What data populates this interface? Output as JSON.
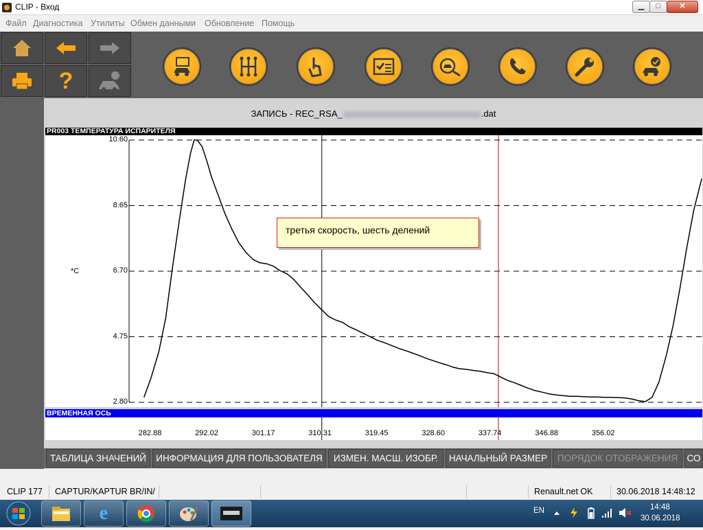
{
  "window": {
    "title": "CLIP - Вход",
    "min_glyph": "▁",
    "max_glyph": "□",
    "close_glyph": "✕"
  },
  "menu": {
    "items": [
      "Файл",
      "Диагностика",
      "Утилиты",
      "Обмен данными",
      "Обновление",
      "Помощь"
    ]
  },
  "toolbar": {
    "nav_buttons": [
      {
        "name": "home-icon"
      },
      {
        "name": "back-arrow-icon"
      },
      {
        "name": "forward-arrow-icon"
      },
      {
        "name": "printer-icon"
      },
      {
        "name": "help-icon",
        "glyph": "?"
      },
      {
        "name": "vehicle-info-icon"
      }
    ],
    "tool_buttons": [
      {
        "name": "vehicle-identification-icon"
      },
      {
        "name": "gearbox-icon"
      },
      {
        "name": "touch-test-icon"
      },
      {
        "name": "checklist-icon"
      },
      {
        "name": "vehicle-scan-icon"
      },
      {
        "name": "phone-support-icon"
      },
      {
        "name": "wrench-icon"
      },
      {
        "name": "vehicle-ok-icon"
      }
    ],
    "accent": "#f8a815"
  },
  "recording": {
    "prefix": "ЗАПИСЬ - REC_RSA_",
    "suffix": ".dat"
  },
  "plot": {
    "header": "PR003  ТЕМПЕРАТУРА ИСПАРИТЕЛЯ",
    "unit": "*C",
    "axis_header": "ВРЕМЕННАЯ ОСЬ",
    "annotation": "третья скорость, шесть делений"
  },
  "chart_data": {
    "type": "line",
    "title": "PR003  ТЕМПЕРАТУРА ИСПАРИТЕЛЯ",
    "ylabel": "*C",
    "xlabel": "ВРЕМЕННАЯ ОСЬ",
    "ylim": [
      2.8,
      10.6
    ],
    "y_ticks": [
      "10.60",
      "8.65",
      "6.70",
      "4.75",
      "2.80"
    ],
    "x_ticks": [
      "282.88",
      "292.02",
      "301.17",
      "310.31",
      "319.45",
      "328.60",
      "337.74",
      "346.88",
      "356.02"
    ],
    "xlim": [
      279.5,
      372.0
    ],
    "grid": true,
    "cursors": [
      {
        "x": 310.6,
        "color": "#000000"
      },
      {
        "x": 339.1,
        "color": "#cc0000"
      }
    ],
    "series": [
      {
        "color": "#000000",
        "x": [
          281.9,
          283.0,
          284.3,
          285.4,
          286.5,
          287.6,
          288.6,
          289.4,
          290.0,
          290.5,
          291.3,
          292.1,
          292.8,
          293.9,
          295.0,
          296.1,
          297.2,
          298.4,
          299.5,
          300.6,
          301.7,
          302.8,
          303.8,
          305.0,
          306.1,
          307.2,
          308.4,
          309.5,
          310.6,
          311.7,
          312.8,
          313.9,
          315.0,
          316.2,
          317.3,
          318.4,
          319.5,
          320.6,
          321.7,
          322.8,
          323.9,
          325.0,
          326.2,
          327.3,
          328.4,
          329.5,
          330.6,
          331.7,
          332.8,
          333.9,
          335.0,
          336.2,
          337.3,
          338.4,
          339.5,
          340.6,
          341.7,
          342.8,
          343.9,
          345.0,
          346.2,
          347.3,
          348.4,
          349.5,
          350.6,
          351.7,
          352.8,
          353.9,
          355.0,
          356.2,
          357.3,
          358.4,
          359.5,
          360.6,
          361.7,
          362.8,
          363.9,
          365.0,
          366.2,
          367.3,
          368.4,
          369.5,
          370.6,
          371.9
        ],
        "y": [
          2.95,
          3.5,
          4.3,
          5.3,
          6.8,
          8.2,
          9.4,
          10.2,
          10.6,
          10.6,
          10.4,
          9.95,
          9.5,
          8.95,
          8.4,
          7.95,
          7.55,
          7.25,
          7.05,
          6.95,
          6.92,
          6.85,
          6.72,
          6.62,
          6.45,
          6.22,
          5.98,
          5.75,
          5.55,
          5.35,
          5.25,
          5.18,
          5.05,
          4.95,
          4.85,
          4.75,
          4.65,
          4.58,
          4.5,
          4.42,
          4.35,
          4.28,
          4.2,
          4.12,
          4.05,
          3.98,
          3.92,
          3.85,
          3.8,
          3.78,
          3.75,
          3.72,
          3.68,
          3.65,
          3.55,
          3.45,
          3.38,
          3.3,
          3.22,
          3.15,
          3.1,
          3.05,
          3.02,
          3.0,
          2.98,
          2.98,
          2.97,
          2.96,
          2.96,
          2.95,
          2.95,
          2.94,
          2.93,
          2.9,
          2.85,
          2.82,
          2.95,
          3.4,
          4.2,
          5.1,
          6.2,
          7.4,
          8.5,
          9.45
        ]
      }
    ]
  },
  "bottom_buttons": [
    {
      "label": "ТАБЛИЦА ЗНАЧЕНИЙ",
      "disabled": false
    },
    {
      "label": "ИНФОРМАЦИЯ ДЛЯ ПОЛЬЗОВАТЕЛЯ",
      "disabled": false
    },
    {
      "label": "ИЗМЕН. МАСШ. ИЗОБР.",
      "disabled": false
    },
    {
      "label": "НАЧАЛЬНЫЙ РАЗМЕР",
      "disabled": false
    },
    {
      "label": "ПОРЯДОК ОТОБРАЖЕНИЯ",
      "disabled": true
    },
    {
      "label": "СО",
      "disabled": false
    }
  ],
  "status": {
    "version": "CLIP 177",
    "vehicle": "CAPTUR/KAPTUR BR/IN/",
    "network": "Renault.net OK",
    "datetime": "30.06.2018 14:48:12"
  },
  "taskbar": {
    "lang": "EN",
    "time": "14:48",
    "date": "30.06.2018",
    "apps": [
      "explorer-icon",
      "internet-explorer-icon",
      "chrome-icon",
      "paint-icon",
      "clip-app-icon"
    ]
  }
}
